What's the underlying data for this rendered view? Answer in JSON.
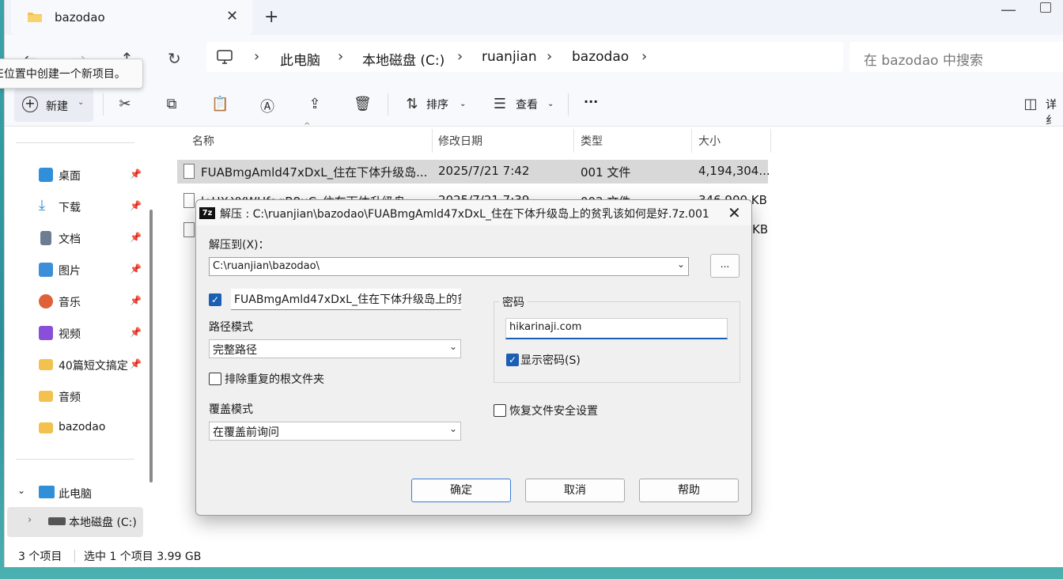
{
  "window": {
    "tab_title": "bazodao",
    "new_tab_symbol": "+"
  },
  "address": {
    "crumbs": [
      "此电脑",
      "本地磁盘 (C:)",
      "ruanjian",
      "bazodao"
    ],
    "search_placeholder": "在 bazodao 中搜索"
  },
  "tooltip": "E位置中创建一个新项目。",
  "toolbar": {
    "new_label": "新建",
    "sort_label": "排序",
    "view_label": "查看",
    "more_label": "···",
    "details_label": "详纟"
  },
  "sidebar": {
    "items": [
      {
        "label": "桌面",
        "icon": "desktop-icon",
        "color": "#2f8fd8"
      },
      {
        "label": "下载",
        "icon": "download-icon",
        "color": "#2a8ad0"
      },
      {
        "label": "文档",
        "icon": "document-icon",
        "color": "#6b7c93"
      },
      {
        "label": "图片",
        "icon": "pictures-icon",
        "color": "#3c8ed8"
      },
      {
        "label": "音乐",
        "icon": "music-icon",
        "color": "#e0603a"
      },
      {
        "label": "视频",
        "icon": "video-icon",
        "color": "#8a4fd8"
      },
      {
        "label": "40篇短文搞定",
        "icon": "folder-icon",
        "color": "#f2c14e"
      },
      {
        "label": "音频",
        "icon": "folder-icon",
        "color": "#f2c14e"
      },
      {
        "label": "bazodao",
        "icon": "folder-icon",
        "color": "#f2c14e"
      }
    ],
    "this_pc": "此电脑",
    "local_disk": "本地磁盘 (C:)"
  },
  "filelist": {
    "columns": [
      "名称",
      "修改日期",
      "类型",
      "大小"
    ],
    "rows": [
      {
        "name": "FUABmgAmld47xDxL_住在下体升级岛...",
        "date": "2025/7/21 7:42",
        "type": "001 文件",
        "size": "4,194,304..."
      },
      {
        "name": "leHX-YYWHfagB8uC_住在下体升级岛...",
        "date": "2025/7/21 7:39",
        "type": "002 文件",
        "size": "346,900 KB"
      },
      {
        "name": "",
        "date": "",
        "type": "",
        "size": "KB"
      }
    ]
  },
  "status": {
    "count": "3 个项目",
    "selection": "选中 1 个项目  3.99 GB"
  },
  "dialog": {
    "title": "解压 : C:\\ruanjian\\bazodao\\FUABmgAmld47xDxL_住在下体升级岛上的贫乳该如何是好.7z.001",
    "app_badge": "7z",
    "extract_to_label": "解压到(X)：",
    "extract_path": "C:\\ruanjian\\bazodao\\",
    "browse_label": "...",
    "subfolder_value": "FUABmgAmld47xDxL_住在下体升级岛上的贫",
    "path_mode_label": "路径模式",
    "path_mode_value": "完整路径",
    "exclude_root_label": "排除重复的根文件夹",
    "overwrite_label": "覆盖模式",
    "overwrite_value": "在覆盖前询问",
    "password_group": "密码",
    "password_value": "hikarinaji.com",
    "show_password_label": "显示密码(S)",
    "restore_security_label": "恢复文件安全设置",
    "ok": "确定",
    "cancel": "取消",
    "help": "帮助"
  }
}
